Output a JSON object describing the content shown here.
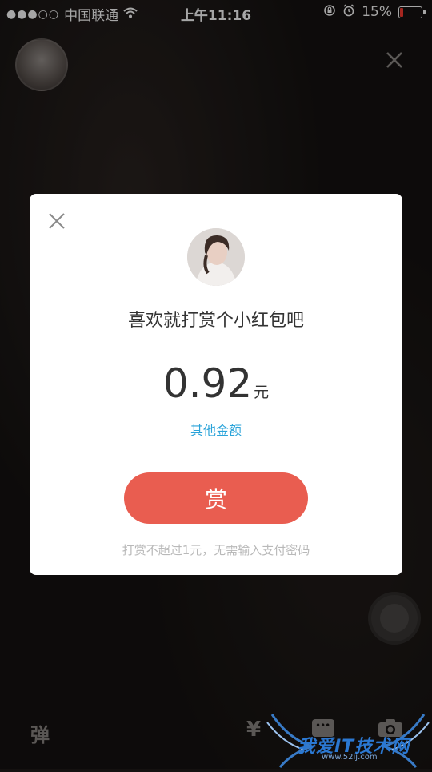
{
  "status_bar": {
    "signal_dots": "●●●○○",
    "carrier": "中国联通",
    "wifi_icon": "wifi-icon",
    "time": "上午11:16",
    "battery_percent": "15%",
    "battery_level": 0.15,
    "battery_color": "#ff3b30"
  },
  "modal": {
    "prompt": "喜欢就打赏个小红包吧",
    "amount": "0.92",
    "unit": "元",
    "other_amount_link": "其他金额",
    "reward_button": "赏",
    "note": "打赏不超过1元，无需输入支付密码",
    "accent_color": "#e95d50",
    "link_color": "#2aa3d9"
  },
  "bottom_bar": {
    "danmu_label": "弹",
    "gift_icon": "¥"
  },
  "watermark": {
    "text": "我爱IT技术网",
    "url": "www.52ij.com"
  }
}
